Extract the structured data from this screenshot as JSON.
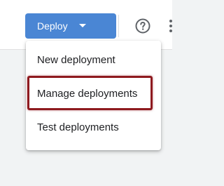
{
  "toolbar": {
    "deploy_label": "Deploy",
    "deploy_caret_icon": "caret-down-icon",
    "help_icon": "help-circle-icon",
    "more_icon": "more-vert-icon"
  },
  "deploy_menu": {
    "items": [
      {
        "label": "New deployment"
      },
      {
        "label": "Manage deployments"
      },
      {
        "label": "Test deployments"
      }
    ],
    "highlighted_item": "Manage deployments",
    "highlight_color": "#8e1a1f"
  },
  "colors": {
    "primary_button": "#4a86d4",
    "menu_text": "#202124",
    "icon": "#5f6368",
    "background": "#f1f3f4"
  }
}
